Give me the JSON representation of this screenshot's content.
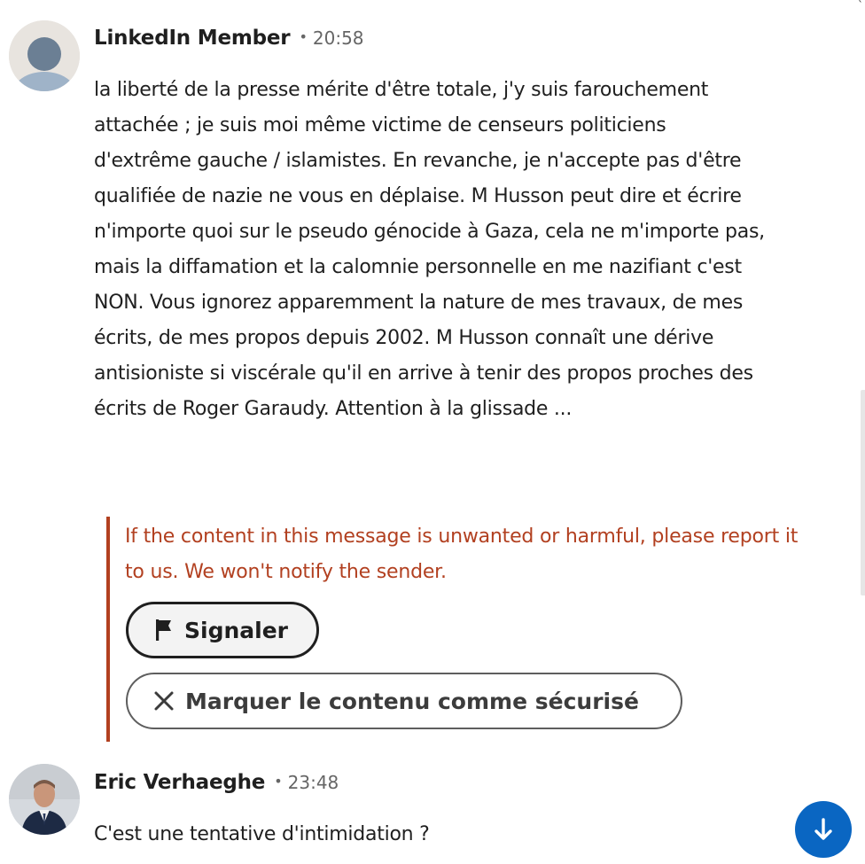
{
  "messages": [
    {
      "sender": "LinkedIn Member",
      "separator": "•",
      "time": "20:58",
      "body": "la liberté de la presse mérite d'être totale, j'y suis farouchement attachée ; je suis moi même victime de censeurs politiciens d'extrême gauche / islamistes. En revanche, je n'accepte pas d'être qualifiée de nazie ne vous en déplaise. M Husson peut dire et écrire n'importe quoi sur le pseudo génocide à Gaza, cela ne m'importe pas, mais la diffamation et la calomnie personnelle en me nazifiant c'est NON. Vous ignorez apparemment la nature de mes travaux, de mes écrits, de mes propos depuis 2002. M Husson connaît une dérive antisioniste si viscérale qu'il en arrive à tenir des propos proches des écrits de Roger Garaudy. Attention à la glissade ...",
      "avatar_icon": "default-person-avatar"
    },
    {
      "sender": "Eric Verhaeghe",
      "separator": "•",
      "time": "23:48",
      "body": "C'est une tentative d'intimidation ?",
      "avatar_icon": "profile-photo-avatar"
    }
  ],
  "warning": {
    "text": "If the content in this message is unwanted or harmful, please report it to us. We won't notify the sender.",
    "report_label": "Signaler",
    "report_icon": "flag-icon",
    "safe_label": "Marquer le contenu comme sécurisé",
    "safe_icon": "close-icon",
    "accent_color": "#b24020"
  },
  "scroll_button": {
    "icon": "arrow-down-icon",
    "color": "#0a66c2"
  },
  "corner_mark": "`"
}
